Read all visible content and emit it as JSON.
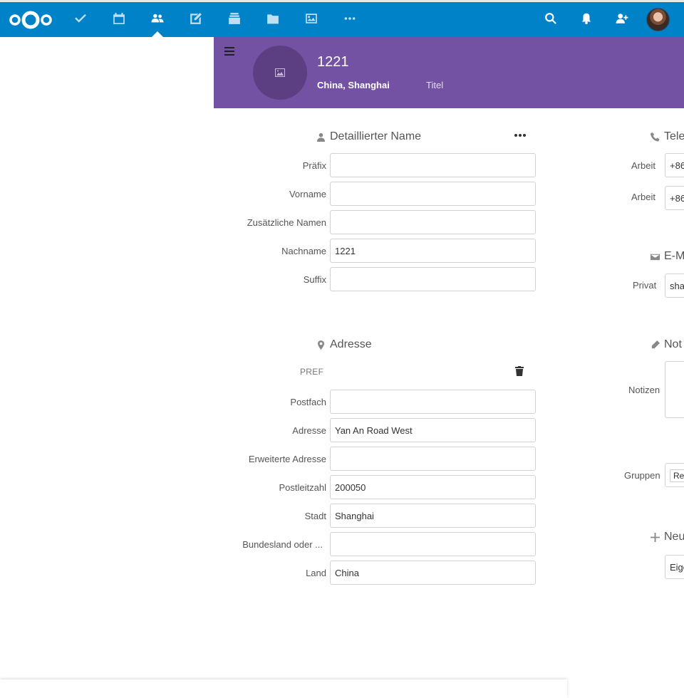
{
  "nav": {
    "apps": [
      {
        "name": "tasks-icon"
      },
      {
        "name": "calendar-icon"
      },
      {
        "name": "contacts-icon"
      },
      {
        "name": "notes-icon"
      },
      {
        "name": "deck-icon"
      },
      {
        "name": "files-icon"
      },
      {
        "name": "photos-icon"
      },
      {
        "name": "more-apps-icon"
      }
    ],
    "active_app": "contacts-icon",
    "right_icons": [
      "search-icon",
      "notifications-icon",
      "contacts-menu-icon",
      "user-avatar"
    ],
    "brand_color": "#0082c9"
  },
  "contact": {
    "name": "1221",
    "org": "China, Shanghai",
    "title_placeholder": "Titel",
    "header_color": "#7452a3"
  },
  "detailed_name": {
    "title": "Detaillierter Name",
    "fields": [
      {
        "label": "Präfix",
        "value": ""
      },
      {
        "label": "Vorname",
        "value": ""
      },
      {
        "label": "Zusätzliche Namen",
        "value": ""
      },
      {
        "label": "Nachname",
        "value": "1221"
      },
      {
        "label": "Suffix",
        "value": ""
      }
    ]
  },
  "address": {
    "title": "Adresse",
    "type": "PREF",
    "fields": [
      {
        "label": "Postfach",
        "value": ""
      },
      {
        "label": "Adresse",
        "value": "Yan An Road West"
      },
      {
        "label": "Erweiterte Adresse",
        "value": ""
      },
      {
        "label": "Postleitzahl",
        "value": "200050"
      },
      {
        "label": "Stadt",
        "value": "Shanghai"
      },
      {
        "label": "Bundesland oder ...",
        "value": ""
      },
      {
        "label": "Land",
        "value": "China"
      }
    ]
  },
  "right_column": {
    "phone_title": "Tele",
    "phone_rows": [
      {
        "label": "Arbeit",
        "value": "+86"
      },
      {
        "label": "Arbeit",
        "value": "+86"
      }
    ],
    "email_title": "E-M",
    "email_row": {
      "label": "Privat",
      "value": "sha"
    },
    "notes_title": "Not",
    "notes_label": "Notizen",
    "groups_label": "Gruppen",
    "groups_value": "Re",
    "new_field_title": "Neu",
    "new_field_value": "Eige"
  }
}
